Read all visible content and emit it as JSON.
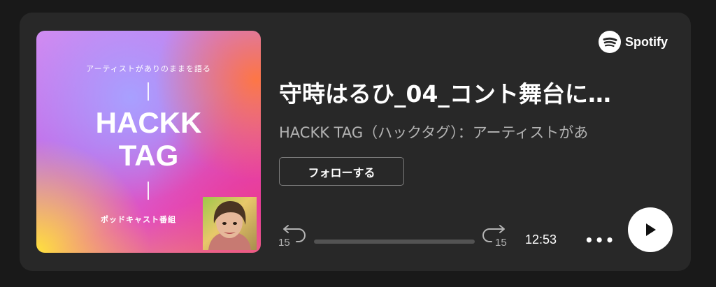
{
  "episode": {
    "title": "守時はるひ_04_コント舞台に…",
    "show": "HACKK TAG（ハックタグ）：アーティストがあ"
  },
  "cover": {
    "tagline": "アーティストがありのままを語る",
    "title_line1": "HACKK",
    "title_line2": "TAG",
    "subtitle": "ポッドキャスト番組"
  },
  "brand": {
    "name": "Spotify"
  },
  "actions": {
    "follow_label": "フォローする",
    "more_label": "•••"
  },
  "player": {
    "skip_back_seconds": "15",
    "skip_forward_seconds": "15",
    "duration": "12:53",
    "progress": 0
  },
  "colors": {
    "card_background": "#282828",
    "page_background": "#191919",
    "text_secondary": "#b3b3b3",
    "button_white": "#ffffff"
  },
  "icons": {
    "spotify": "spotify-logo-icon",
    "skip_back": "skip-back-15-icon",
    "skip_forward": "skip-forward-15-icon",
    "more": "more-dots-icon",
    "play": "play-icon"
  }
}
